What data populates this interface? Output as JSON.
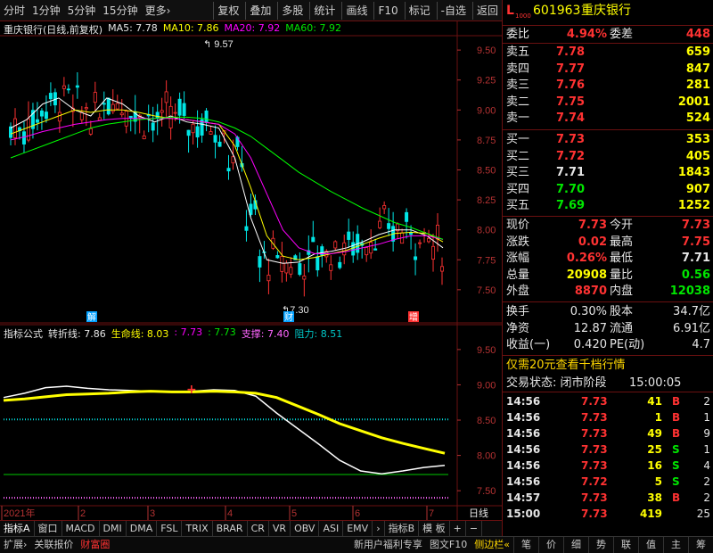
{
  "toolbar": {
    "left": [
      "分时",
      "1分钟",
      "5分钟",
      "15分钟",
      "更多›"
    ],
    "right": [
      "复权",
      "叠加",
      "多股",
      "统计",
      "画线",
      "F10",
      "标记",
      "-自选",
      "返回"
    ]
  },
  "chart_title": {
    "name": "重庆银行(日线,前复权)",
    "ma5": "MA5: 7.78",
    "ma10": "MA10: 7.86",
    "ma20": "MA20: 7.92",
    "ma60": "MA60: 7.92"
  },
  "indicator_title": {
    "name": "指标公式",
    "turn": "转折线: 7.86",
    "life": "生命线: 8.03",
    "v1": ": 7.73",
    "v2": ": 7.73",
    "support": "支撑: 7.40",
    "resist": "阻力: 8.51"
  },
  "price_axis": [
    "9.50",
    "9.25",
    "9.00",
    "8.75",
    "8.50",
    "8.25",
    "8.00",
    "7.75",
    "7.50"
  ],
  "ind_axis": [
    "9.50",
    "9.00",
    "8.50",
    "8.00",
    "7.50"
  ],
  "annotations": {
    "high": "9.57",
    "low": "7.30",
    "markers": [
      "解",
      "财",
      "增"
    ]
  },
  "time_axis": [
    "2021年",
    "2",
    "3",
    "4",
    "5",
    "6",
    "7"
  ],
  "period_label": "日线",
  "bottom_tabs": [
    "指标A",
    "窗口",
    "MACD",
    "DMI",
    "DMA",
    "FSL",
    "TRIX",
    "BRAR",
    "CR",
    "VR",
    "OBV",
    "ASI",
    "EMV",
    "›",
    "指标B",
    "模 板",
    "+",
    "−"
  ],
  "bottom_bar": {
    "left": [
      "扩展›",
      "关联报价",
      "财富圈"
    ],
    "mid": [
      "新用户福利专享",
      "图文F10",
      "侧边栏«"
    ],
    "right": [
      "笔",
      "价",
      "细",
      "势",
      "联",
      "值",
      "主",
      "筹"
    ]
  },
  "quote": {
    "code": "601963",
    "name": "重庆银行",
    "lvl": "L1000",
    "weibi_label": "委比",
    "weibi": "4.94%",
    "weicha_label": "委差",
    "weicha": "448",
    "sell": [
      {
        "l": "卖五",
        "p": "7.78",
        "v": "659"
      },
      {
        "l": "卖四",
        "p": "7.77",
        "v": "847"
      },
      {
        "l": "卖三",
        "p": "7.76",
        "v": "281"
      },
      {
        "l": "卖二",
        "p": "7.75",
        "v": "2001"
      },
      {
        "l": "卖一",
        "p": "7.74",
        "v": "524"
      }
    ],
    "buy": [
      {
        "l": "买一",
        "p": "7.73",
        "v": "353"
      },
      {
        "l": "买二",
        "p": "7.72",
        "v": "405"
      },
      {
        "l": "买三",
        "p": "7.71",
        "v": "1843"
      },
      {
        "l": "买四",
        "p": "7.70",
        "v": "907"
      },
      {
        "l": "买五",
        "p": "7.69",
        "v": "1252"
      }
    ],
    "stats": [
      {
        "a": "现价",
        "av": "7.73",
        "b": "今开",
        "bv": "7.73"
      },
      {
        "a": "涨跌",
        "av": "0.02",
        "b": "最高",
        "bv": "7.75"
      },
      {
        "a": "涨幅",
        "av": "0.26%",
        "b": "最低",
        "bv": "7.71"
      },
      {
        "a": "总量",
        "av": "20908",
        "b": "量比",
        "bv": "0.56"
      },
      {
        "a": "外盘",
        "av": "8870",
        "b": "内盘",
        "bv": "12038"
      }
    ],
    "stats2": [
      {
        "a": "换手",
        "av": "0.30%",
        "b": "股本",
        "bv": "34.7亿"
      },
      {
        "a": "净资",
        "av": "12.87",
        "b": "流通",
        "bv": "6.91亿"
      },
      {
        "a": "收益(一)",
        "av": "0.420",
        "b": "PE(动)",
        "bv": "4.7"
      }
    ],
    "promo": "仅需20元查看千档行情",
    "status_label": "交易状态: 闭市阶段",
    "status_time": "15:00:05",
    "ticks": [
      {
        "t": "14:56",
        "p": "7.73",
        "v": "41",
        "d": "B",
        "n": "2"
      },
      {
        "t": "14:56",
        "p": "7.73",
        "v": "1",
        "d": "B",
        "n": "1"
      },
      {
        "t": "14:56",
        "p": "7.73",
        "v": "49",
        "d": "B",
        "n": "9"
      },
      {
        "t": "14:56",
        "p": "7.73",
        "v": "25",
        "d": "S",
        "n": "1"
      },
      {
        "t": "14:56",
        "p": "7.73",
        "v": "16",
        "d": "S",
        "n": "4"
      },
      {
        "t": "14:56",
        "p": "7.72",
        "v": "5",
        "d": "S",
        "n": "2"
      },
      {
        "t": "14:57",
        "p": "7.73",
        "v": "38",
        "d": "B",
        "n": "2"
      },
      {
        "t": "15:00",
        "p": "7.73",
        "v": "419",
        "d": "",
        "n": "25"
      }
    ]
  },
  "colors": {
    "up": "#ff3232",
    "down": "#00e600",
    "ma5": "#ffffff",
    "ma10": "#ffff00",
    "ma20": "#ff00ff",
    "ma60": "#00ff00",
    "frame": "#6a1010"
  },
  "chart_data": {
    "type": "candlestick",
    "ylim": [
      7.35,
      9.62
    ],
    "axis_labels": [
      "9.50",
      "9.25",
      "9.00",
      "8.75",
      "8.50",
      "8.25",
      "8.00",
      "7.75",
      "7.50"
    ],
    "series": [
      {
        "name": "MA5",
        "values": [
          8.85,
          8.92,
          9.05,
          9.1,
          9.0,
          8.95,
          9.1,
          9.05,
          8.95,
          8.9,
          8.95,
          8.9,
          8.88,
          8.85,
          8.6,
          8.1,
          7.75,
          7.72,
          7.73,
          7.8,
          7.82,
          7.85,
          7.9,
          7.96,
          8.0,
          8.0,
          7.95,
          7.85
        ]
      },
      {
        "name": "MA10",
        "values": [
          8.8,
          8.85,
          8.9,
          8.95,
          9.0,
          8.98,
          9.0,
          9.0,
          8.98,
          8.95,
          8.93,
          8.92,
          8.9,
          8.88,
          8.7,
          8.35,
          7.95,
          7.78,
          7.75,
          7.77,
          7.8,
          7.83,
          7.88,
          7.93,
          7.97,
          7.98,
          7.97,
          7.9
        ]
      },
      {
        "name": "MA20",
        "values": [
          8.75,
          8.78,
          8.82,
          8.85,
          8.88,
          8.9,
          8.92,
          8.93,
          8.93,
          8.93,
          8.93,
          8.92,
          8.9,
          8.88,
          8.8,
          8.6,
          8.3,
          8.0,
          7.85,
          7.8,
          7.8,
          7.82,
          7.85,
          7.88,
          7.92,
          7.95,
          7.95,
          7.92
        ]
      },
      {
        "name": "MA60",
        "values": [
          8.6,
          8.65,
          8.7,
          8.75,
          8.8,
          8.85,
          8.88,
          8.9,
          8.92,
          8.93,
          8.94,
          8.94,
          8.93,
          8.9,
          8.85,
          8.78,
          8.68,
          8.58,
          8.48,
          8.4,
          8.32,
          8.25,
          8.18,
          8.12,
          8.06,
          8.02,
          7.97,
          7.92
        ]
      }
    ]
  }
}
